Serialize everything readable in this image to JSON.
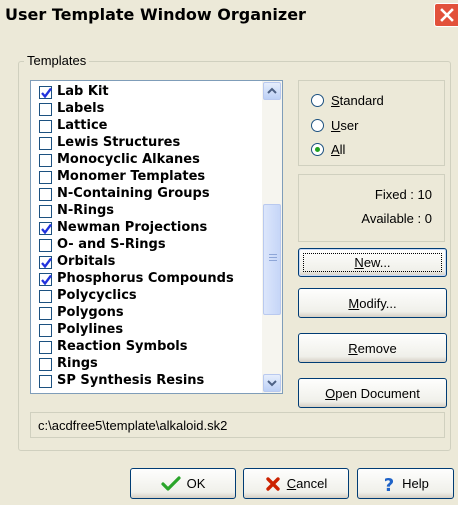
{
  "window": {
    "title": "User Template Window Organizer"
  },
  "templates": {
    "group_label": "Templates",
    "items": [
      {
        "label": "Lab Kit",
        "checked": true
      },
      {
        "label": "Labels",
        "checked": false
      },
      {
        "label": "Lattice",
        "checked": false
      },
      {
        "label": "Lewis Structures",
        "checked": false
      },
      {
        "label": "Monocyclic Alkanes",
        "checked": false
      },
      {
        "label": "Monomer Templates",
        "checked": false
      },
      {
        "label": "N-Containing Groups",
        "checked": false
      },
      {
        "label": "N-Rings",
        "checked": false
      },
      {
        "label": "Newman Projections",
        "checked": true
      },
      {
        "label": "O- and S-Rings",
        "checked": false
      },
      {
        "label": "Orbitals",
        "checked": true
      },
      {
        "label": "Phosphorus Compounds",
        "checked": true
      },
      {
        "label": "Polycyclics",
        "checked": false
      },
      {
        "label": "Polygons",
        "checked": false
      },
      {
        "label": "Polylines",
        "checked": false
      },
      {
        "label": "Reaction Symbols",
        "checked": false
      },
      {
        "label": "Rings",
        "checked": false
      },
      {
        "label": "SP Synthesis Resins",
        "checked": false
      }
    ]
  },
  "filter": {
    "options": [
      {
        "label": "Standard",
        "accel": "S",
        "selected": false
      },
      {
        "label": "User",
        "accel": "U",
        "selected": false
      },
      {
        "label": "All",
        "accel": "A",
        "selected": true
      }
    ]
  },
  "info": {
    "fixed_label": "Fixed :",
    "fixed_value": "10",
    "available_label": "Available :",
    "available_value": "0"
  },
  "buttons": {
    "new_label": "New...",
    "new_accel": "N",
    "modify_label": "Modify...",
    "modify_accel": "M",
    "remove_label": "Remove",
    "remove_accel": "R",
    "open_label": "Open Document",
    "open_accel": "O"
  },
  "path": "c:\\acdfree5\\template\\alkaloid.sk2",
  "footer": {
    "ok_label": "OK",
    "cancel_label": "Cancel",
    "cancel_accel": "C",
    "help_label": "Help"
  },
  "colors": {
    "check": "#2233dd",
    "radio_dot": "#21a121",
    "ok_check": "#2aa52a",
    "cancel_x": "#cc2200",
    "help": "#1f63c8"
  }
}
